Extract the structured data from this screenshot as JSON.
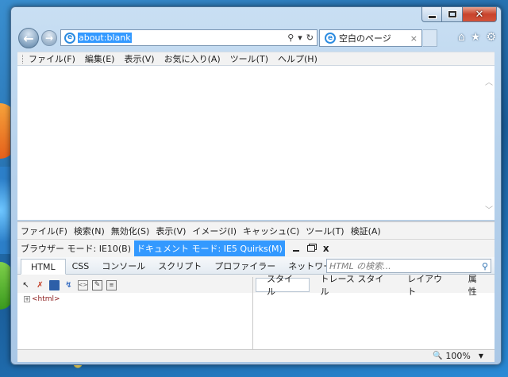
{
  "address_bar": {
    "url": "about:blank",
    "search_icon": "search-icon",
    "dropdown_icon": "chevron-down-icon",
    "refresh_icon": "refresh-icon"
  },
  "tab": {
    "title": "空白のページ",
    "close": "×"
  },
  "toolbar_icons": {
    "home": "⌂",
    "favorites": "★",
    "tools": "⚙"
  },
  "menubar": {
    "items": [
      "ファイル(F)",
      "編集(E)",
      "表示(V)",
      "お気に入り(A)",
      "ツール(T)",
      "ヘルプ(H)"
    ]
  },
  "devtools": {
    "menubar": [
      "ファイル(F)",
      "検索(N)",
      "無効化(S)",
      "表示(V)",
      "イメージ(I)",
      "キャッシュ(C)",
      "ツール(T)",
      "検証(A)"
    ],
    "browser_mode": "ブラウザー モード: IE10(B)",
    "document_mode": "ドキュメント モード: IE5 Quirks(M)",
    "close": "x",
    "tabs": [
      "HTML",
      "CSS",
      "コンソール",
      "スクリプト",
      "プロファイラー",
      "ネットワーク"
    ],
    "search_placeholder": "HTML の検索...",
    "tree_root": "<html>",
    "tree_expander": "+",
    "right_tabs": [
      "スタイル",
      "トレース スタイル",
      "レイアウト",
      "属性"
    ]
  },
  "status": {
    "zoom": "100%"
  },
  "colors": {
    "selection": "#3399ff",
    "desktop": "#2b6ea6"
  }
}
